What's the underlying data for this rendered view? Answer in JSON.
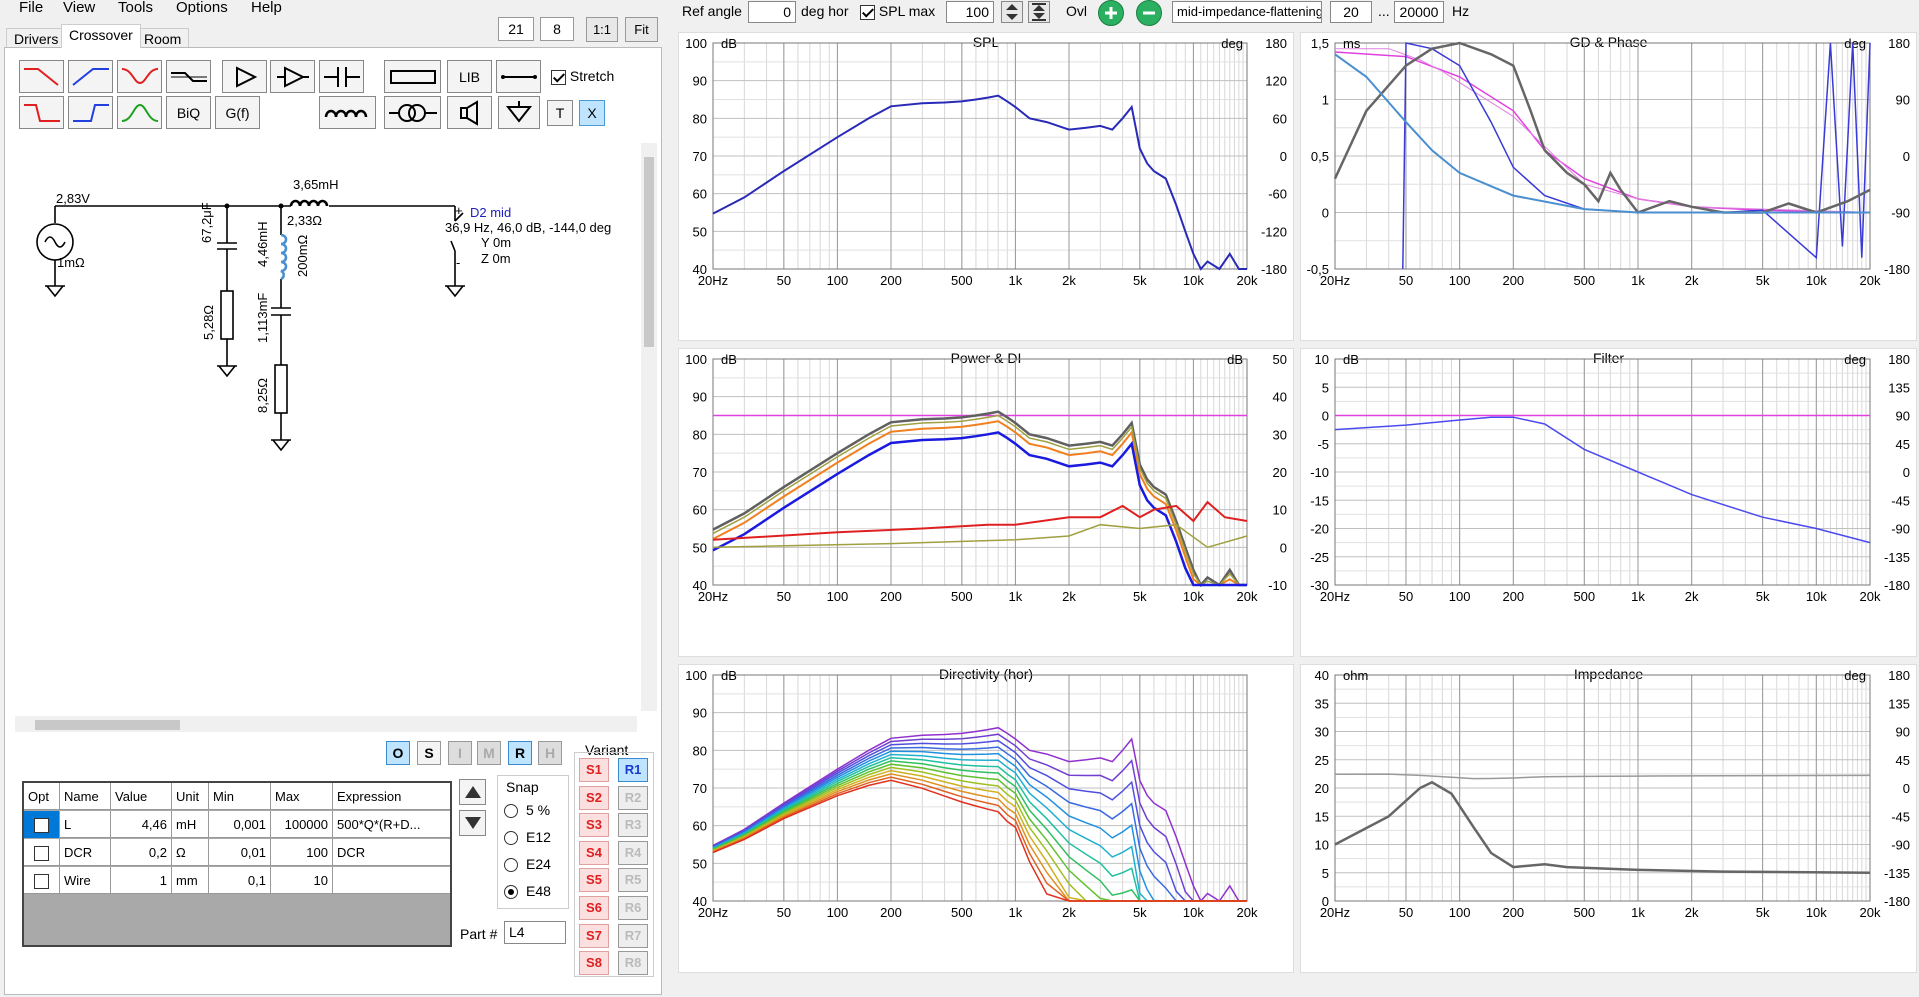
{
  "menu": {
    "items": [
      "File",
      "View",
      "Tools",
      "Options",
      "Help"
    ]
  },
  "tabs": [
    "Drivers",
    "Crossover",
    "Room"
  ],
  "zoom": {
    "a": "21",
    "b": "8",
    "one": "1:1",
    "fit": "Fit"
  },
  "toolbar": {
    "lib": "LIB",
    "biq": "BiQ",
    "gf": "G(f)",
    "stretch": "Stretch",
    "t": "T",
    "x": "X"
  },
  "schematic": {
    "source_v": "2,83V",
    "source_r": "1mΩ",
    "l1": "3,65mH",
    "l1_r": "2,33Ω",
    "c1": "67,2μF",
    "r1": "5,28Ω",
    "l2": "4,46mH",
    "l2_r": "200mΩ",
    "c2": "1,113mF",
    "r2": "8,25Ω",
    "driver": "D2 mid",
    "driver_info": "36,9 Hz, 46,0 dB, -144,0 deg",
    "y": "Y  0m",
    "z": "Z  0m",
    "plus": "+",
    "minus": "-"
  },
  "os_buttons": [
    "O",
    "S",
    "I",
    "M",
    "R",
    "H"
  ],
  "table": {
    "headers": [
      "Opt",
      "Name",
      "Value",
      "Unit",
      "Min",
      "Max",
      "Expression"
    ],
    "rows": [
      {
        "name": "L",
        "value": "4,46",
        "unit": "mH",
        "min": "0,001",
        "max": "100000",
        "expr": "500*Q*(R+D..."
      },
      {
        "name": "DCR",
        "value": "0,2",
        "unit": "Ω",
        "min": "0,01",
        "max": "100",
        "expr": "DCR"
      },
      {
        "name": "Wire",
        "value": "1",
        "unit": "mm",
        "min": "0,1",
        "max": "10",
        "expr": ""
      }
    ]
  },
  "snap": {
    "title": "Snap",
    "options": [
      "5 %",
      "E12",
      "E24",
      "E48"
    ],
    "selected": "E48"
  },
  "part": {
    "label": "Part #",
    "value": "L4"
  },
  "variant": {
    "title": "Variant",
    "s": [
      "S1",
      "S2",
      "S3",
      "S4",
      "S5",
      "S6",
      "S7",
      "S8"
    ],
    "r": [
      "R1",
      "R2",
      "R3",
      "R4",
      "R5",
      "R6",
      "R7",
      "R8"
    ]
  },
  "topbar": {
    "ref_angle_label": "Ref angle",
    "ref_angle": "0",
    "deg_hor": "deg hor",
    "spl_max_label": "SPL max",
    "spl_max": "100",
    "ovl": "Ovl",
    "target": "mid-impedance-flattening",
    "f_from": "20",
    "dots": "...",
    "f_to": "20000",
    "hz": "Hz"
  },
  "colors": {
    "pink": "#e040e0",
    "blue": "#2a2ab8",
    "gray": "#606060",
    "lightblue": "#4a8fd0",
    "red": "#e02020",
    "orange": "#f08020"
  },
  "charts": {
    "spl": {
      "title": "SPL",
      "lunit": "dB",
      "runit": "deg",
      "left": [
        "100",
        "90",
        "80",
        "70",
        "60",
        "50",
        "40"
      ],
      "right": [
        "180",
        "120",
        "60",
        "0",
        "-60",
        "-120",
        "-180"
      ]
    },
    "gd": {
      "title": "GD & Phase",
      "lunit": "ms",
      "runit": "deg",
      "left": [
        "1,5",
        "1",
        "0,5",
        "0",
        "-0,5"
      ],
      "right": [
        "180",
        "90",
        "0",
        "-90",
        "-180"
      ]
    },
    "power": {
      "title": "Power & DI",
      "lunit": "dB",
      "runit": "dB",
      "left": [
        "100",
        "90",
        "80",
        "70",
        "60",
        "50",
        "40"
      ],
      "right": [
        "50",
        "40",
        "30",
        "20",
        "10",
        "0",
        "-10"
      ]
    },
    "filter": {
      "title": "Filter",
      "lunit": "dB",
      "runit": "deg",
      "left": [
        "10",
        "5",
        "0",
        "-5",
        "-10",
        "-15",
        "-20",
        "-25",
        "-30"
      ],
      "right": [
        "180",
        "135",
        "90",
        "45",
        "0",
        "-45",
        "-90",
        "-135",
        "-180"
      ]
    },
    "directivity": {
      "title": "Directivity (hor)",
      "lunit": "dB",
      "left": [
        "100",
        "90",
        "80",
        "70",
        "60",
        "50",
        "40"
      ]
    },
    "impedance": {
      "title": "Impedance",
      "lunit": "ohm",
      "runit": "deg",
      "left": [
        "40",
        "35",
        "30",
        "25",
        "20",
        "15",
        "10",
        "5",
        "0"
      ],
      "right": [
        "180",
        "135",
        "90",
        "45",
        "0",
        "-45",
        "-90",
        "-135",
        "-180"
      ]
    },
    "xticks": [
      "20Hz",
      "50",
      "100",
      "200",
      "500",
      "1k",
      "2k",
      "5k",
      "10k",
      "20k"
    ]
  }
}
